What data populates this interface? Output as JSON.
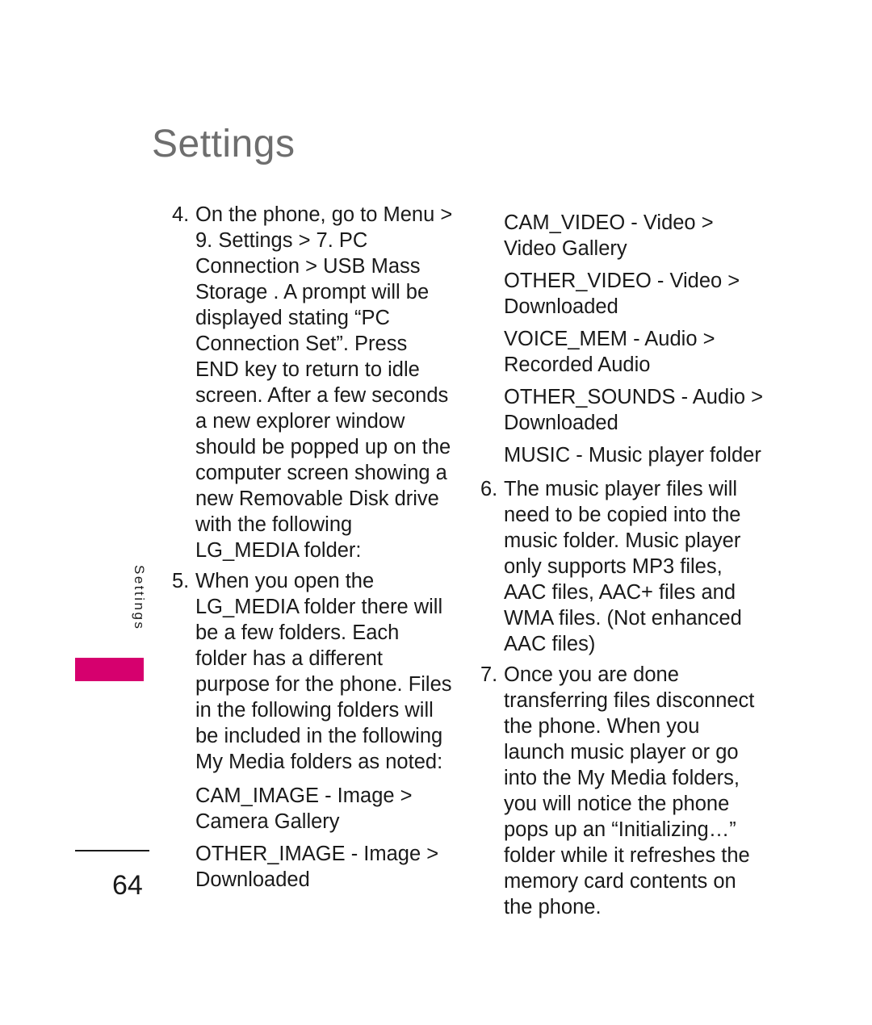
{
  "page": {
    "title": "Settings",
    "folio": "64",
    "side_tab_label": "Settings",
    "accent_color": "#d6006e",
    "title_color": "#6e6e6e",
    "text_color": "#1a1a1a"
  },
  "left_column": {
    "steps": [
      {
        "number": "4.",
        "text": "On the phone, go to Menu > 9. Settings > 7. PC Connection > USB Mass Storage . A prompt will be displayed stating “PC Connection Set”. Press END key to return to idle screen.  After a few seconds a new explorer window should be popped up on the computer screen showing a new Removable Disk drive with the following LG_MEDIA folder:"
      },
      {
        "number": "5.",
        "text": "When you open the LG_MEDIA folder there will be a few folders. Each folder has a different purpose for the phone.  Files in the following folders will be included in the following My Media folders as noted:"
      }
    ],
    "folder_mappings": [
      "CAM_IMAGE - Image > Camera Gallery",
      "OTHER_IMAGE -  Image > Downloaded"
    ]
  },
  "right_column": {
    "folder_mappings": [
      "CAM_VIDEO - Video > Video Gallery",
      "OTHER_VIDEO - Video > Downloaded",
      "VOICE_MEM - Audio > Recorded Audio",
      "OTHER_SOUNDS - Audio > Downloaded",
      "MUSIC - Music player folder"
    ],
    "steps": [
      {
        "number": "6.",
        "text": "The music player files will need to be copied into the music folder. Music player only supports MP3 files, AAC files, AAC+ files and WMA files. (Not enhanced AAC files)"
      },
      {
        "number": "7.",
        "text": "Once you are done transferring files disconnect the phone.  When you launch music player or go into the My Media folders, you will notice the phone pops up an “Initializing…” folder while it refreshes the memory card contents on the phone."
      }
    ]
  }
}
